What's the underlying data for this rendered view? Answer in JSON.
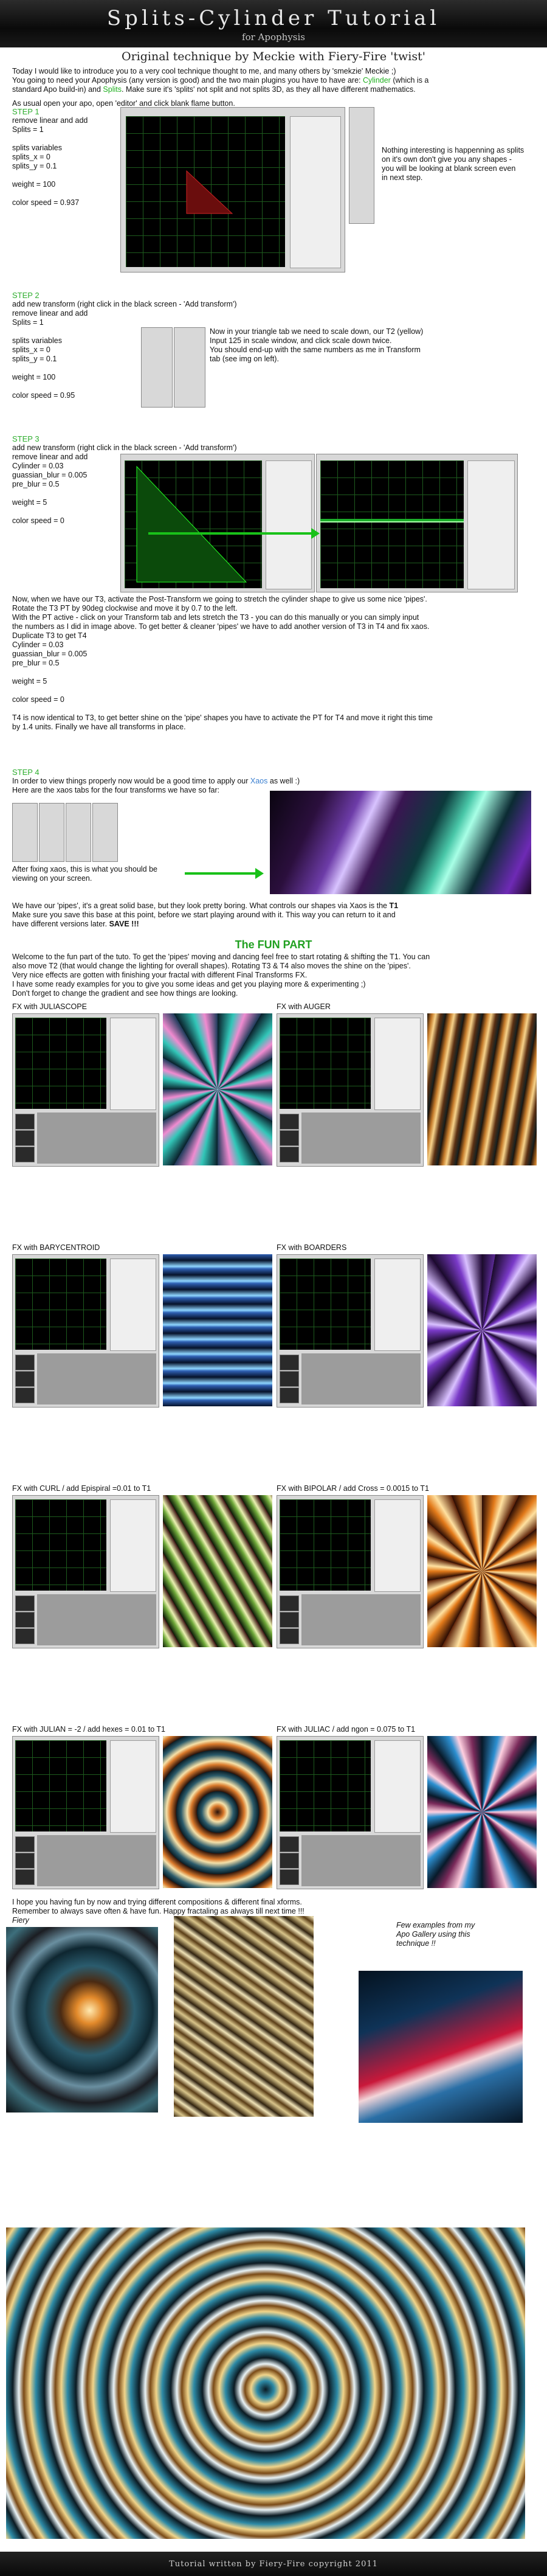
{
  "header": {
    "title": "Splits-Cylinder Tutorial",
    "subtitle": "for Apophysis",
    "byline": "Original technique by Meckie with Fiery-Fire 'twist'"
  },
  "intro": {
    "line1": "Today I would like to introduce you to a very cool technique thought to me, and many others by 'smekzie' Meckie ;)",
    "line2a": "You going to need your Apophysis (any version is good) and the two main plugins you have to have are: ",
    "cylinder": "Cylinder",
    "line2b": " (which is a",
    "line3a": "standard Apo build-in) and ",
    "splits": "Splits",
    "line3b": ". Make sure it's 'splits' not split and not splits 3D, as they all have different mathematics.",
    "line4": "As usual open your apo, open 'editor' and click blank flame button."
  },
  "step1": {
    "label": "STEP 1",
    "lines": [
      "remove linear and add",
      "Splits = 1",
      "",
      "splits variables",
      "splits_x = 0",
      "splits_y = 0.1",
      "",
      "weight = 100",
      "",
      "color speed = 0.937"
    ],
    "note": [
      "Nothing interesting is happenning as splits",
      "on it's own don't give you any shapes -",
      "you will be looking at blank screen even",
      "in next step."
    ]
  },
  "step2": {
    "label": "STEP 2",
    "lines": [
      "add new transform (right click in the black screen - 'Add transform')",
      "remove linear and add",
      "Splits = 1",
      "",
      "splits variables",
      "splits_x = 0",
      "splits_y = 0.1",
      "",
      "weight = 100",
      "",
      "color speed = 0.95"
    ],
    "note": [
      "Now in your triangle tab we need to scale down, our T2 (yellow)",
      "Input 125 in scale window, and click scale down twice.",
      "You should end-up with the same numbers as me in Transform",
      "tab (see img on left)."
    ]
  },
  "step3": {
    "label": "STEP 3",
    "lines": [
      "add new transform (right click in the black screen - 'Add transform')",
      "remove linear and add",
      "Cylinder = 0.03",
      "guassian_blur = 0.005",
      "pre_blur = 0.5",
      "",
      "weight = 5",
      "",
      "color speed = 0"
    ]
  },
  "step3b": {
    "lines": [
      "Now, when we have our T3, activate the Post-Transform we going to stretch the cylinder shape to give us some nice 'pipes'.",
      "Rotate the T3 PT by 90deg clockwise and move it by 0.7 to the left.",
      "With the PT active - click on your Transform tab and lets stretch the T3 - you can do this manually or you can simply input",
      "the numbers as I did in image above. To get better & cleaner 'pipes' we have to add another version of T3 in T4 and fix xaos.",
      "Duplicate T3 to get T4",
      "Cylinder = 0.03",
      "guassian_blur = 0.005",
      "pre_blur = 0.5",
      "",
      "weight = 5",
      "",
      "color speed = 0",
      "",
      "T4 is now identical to T3, to get better shine on the 'pipe' shapes you have to activate the PT for T4 and move it right this time",
      "by 1.4 units. Finally we have all transforms in place."
    ]
  },
  "step4": {
    "label": "STEP 4",
    "line1a": "In order to view things properly now would be a good time to apply our ",
    "xaos": "Xaos",
    "line1b": " as well :)",
    "line2": "Here are the xaos tabs for the four  transforms we have so far:",
    "after": [
      "After fixing xaos, this is what you should be",
      "viewing on your screen."
    ]
  },
  "pipes": {
    "line1a": "We have our 'pipes', it's a great solid base, but they look pretty boring. What controls our shapes via Xaos is the ",
    "t1": "T1",
    "line2a": "Make sure you save this base at this point, before we start playing around with it. This way you can return to it and",
    "line3a": "have different versions later.   ",
    "save": "SAVE !!!"
  },
  "funpart": {
    "title": "The FUN PART",
    "lines": [
      "Welcome to the fun part of the tuto. To get the 'pipes' moving and dancing feel free to start rotating & shifting the T1. You can",
      "also move T2 (that would change the lighting for overall shapes). Rotating T3 & T4 also moves the shine on the 'pipes'.",
      "Very nice effects are gotten with finishing your fractal with different Final Transforms FX.",
      "I have some ready examples for you to give you some ideas and get you playing more & experimenting ;)",
      "Don't forget to change the gradient and see how things are looking."
    ]
  },
  "fx": [
    {
      "label": "FX with JULIASCOPE"
    },
    {
      "label": "FX with AUGER"
    },
    {
      "label": "FX with BARYCENTROID"
    },
    {
      "label": "FX with BOARDERS"
    },
    {
      "label": "FX with CURL / add Epispiral =0.01 to T1"
    },
    {
      "label": "FX with BIPOLAR / add Cross = 0.0015 to T1"
    },
    {
      "label": "FX with JULIAN = -2 / add hexes = 0.01 to T1"
    },
    {
      "label": "FX with JULIAC / add ngon = 0.075 to T1"
    }
  ],
  "closing": {
    "lines": [
      "I hope you having fun by now and trying different compositions & different final xforms.",
      "Remember to always save often & have fun. Happy fractaling as always till next time !!!"
    ],
    "sign": "Fiery",
    "examples": [
      "Few examples from my",
      "Apo Gallery using this",
      "technique !!"
    ]
  },
  "footer": {
    "text": "Tutorial written by Fiery-Fire copyright 2011"
  },
  "colors": {
    "accent_green": "#20b020",
    "link_blue": "#3a7fd0",
    "banner_bg": "#111111"
  }
}
